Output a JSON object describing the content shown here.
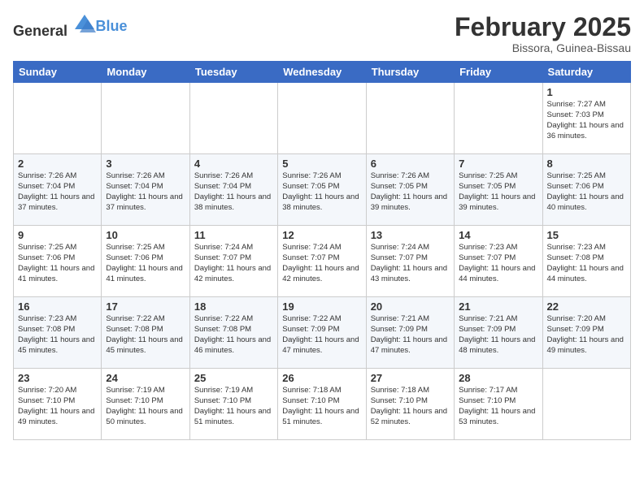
{
  "header": {
    "logo_general": "General",
    "logo_blue": "Blue",
    "month": "February 2025",
    "location": "Bissora, Guinea-Bissau"
  },
  "weekdays": [
    "Sunday",
    "Monday",
    "Tuesday",
    "Wednesday",
    "Thursday",
    "Friday",
    "Saturday"
  ],
  "weeks": [
    [
      {
        "day": "",
        "info": ""
      },
      {
        "day": "",
        "info": ""
      },
      {
        "day": "",
        "info": ""
      },
      {
        "day": "",
        "info": ""
      },
      {
        "day": "",
        "info": ""
      },
      {
        "day": "",
        "info": ""
      },
      {
        "day": "1",
        "info": "Sunrise: 7:27 AM\nSunset: 7:03 PM\nDaylight: 11 hours\nand 36 minutes."
      }
    ],
    [
      {
        "day": "2",
        "info": "Sunrise: 7:26 AM\nSunset: 7:04 PM\nDaylight: 11 hours\nand 37 minutes."
      },
      {
        "day": "3",
        "info": "Sunrise: 7:26 AM\nSunset: 7:04 PM\nDaylight: 11 hours\nand 37 minutes."
      },
      {
        "day": "4",
        "info": "Sunrise: 7:26 AM\nSunset: 7:04 PM\nDaylight: 11 hours\nand 38 minutes."
      },
      {
        "day": "5",
        "info": "Sunrise: 7:26 AM\nSunset: 7:05 PM\nDaylight: 11 hours\nand 38 minutes."
      },
      {
        "day": "6",
        "info": "Sunrise: 7:26 AM\nSunset: 7:05 PM\nDaylight: 11 hours\nand 39 minutes."
      },
      {
        "day": "7",
        "info": "Sunrise: 7:25 AM\nSunset: 7:05 PM\nDaylight: 11 hours\nand 39 minutes."
      },
      {
        "day": "8",
        "info": "Sunrise: 7:25 AM\nSunset: 7:06 PM\nDaylight: 11 hours\nand 40 minutes."
      }
    ],
    [
      {
        "day": "9",
        "info": "Sunrise: 7:25 AM\nSunset: 7:06 PM\nDaylight: 11 hours\nand 41 minutes."
      },
      {
        "day": "10",
        "info": "Sunrise: 7:25 AM\nSunset: 7:06 PM\nDaylight: 11 hours\nand 41 minutes."
      },
      {
        "day": "11",
        "info": "Sunrise: 7:24 AM\nSunset: 7:07 PM\nDaylight: 11 hours\nand 42 minutes."
      },
      {
        "day": "12",
        "info": "Sunrise: 7:24 AM\nSunset: 7:07 PM\nDaylight: 11 hours\nand 42 minutes."
      },
      {
        "day": "13",
        "info": "Sunrise: 7:24 AM\nSunset: 7:07 PM\nDaylight: 11 hours\nand 43 minutes."
      },
      {
        "day": "14",
        "info": "Sunrise: 7:23 AM\nSunset: 7:07 PM\nDaylight: 11 hours\nand 44 minutes."
      },
      {
        "day": "15",
        "info": "Sunrise: 7:23 AM\nSunset: 7:08 PM\nDaylight: 11 hours\nand 44 minutes."
      }
    ],
    [
      {
        "day": "16",
        "info": "Sunrise: 7:23 AM\nSunset: 7:08 PM\nDaylight: 11 hours\nand 45 minutes."
      },
      {
        "day": "17",
        "info": "Sunrise: 7:22 AM\nSunset: 7:08 PM\nDaylight: 11 hours\nand 45 minutes."
      },
      {
        "day": "18",
        "info": "Sunrise: 7:22 AM\nSunset: 7:08 PM\nDaylight: 11 hours\nand 46 minutes."
      },
      {
        "day": "19",
        "info": "Sunrise: 7:22 AM\nSunset: 7:09 PM\nDaylight: 11 hours\nand 47 minutes."
      },
      {
        "day": "20",
        "info": "Sunrise: 7:21 AM\nSunset: 7:09 PM\nDaylight: 11 hours\nand 47 minutes."
      },
      {
        "day": "21",
        "info": "Sunrise: 7:21 AM\nSunset: 7:09 PM\nDaylight: 11 hours\nand 48 minutes."
      },
      {
        "day": "22",
        "info": "Sunrise: 7:20 AM\nSunset: 7:09 PM\nDaylight: 11 hours\nand 49 minutes."
      }
    ],
    [
      {
        "day": "23",
        "info": "Sunrise: 7:20 AM\nSunset: 7:10 PM\nDaylight: 11 hours\nand 49 minutes."
      },
      {
        "day": "24",
        "info": "Sunrise: 7:19 AM\nSunset: 7:10 PM\nDaylight: 11 hours\nand 50 minutes."
      },
      {
        "day": "25",
        "info": "Sunrise: 7:19 AM\nSunset: 7:10 PM\nDaylight: 11 hours\nand 51 minutes."
      },
      {
        "day": "26",
        "info": "Sunrise: 7:18 AM\nSunset: 7:10 PM\nDaylight: 11 hours\nand 51 minutes."
      },
      {
        "day": "27",
        "info": "Sunrise: 7:18 AM\nSunset: 7:10 PM\nDaylight: 11 hours\nand 52 minutes."
      },
      {
        "day": "28",
        "info": "Sunrise: 7:17 AM\nSunset: 7:10 PM\nDaylight: 11 hours\nand 53 minutes."
      },
      {
        "day": "",
        "info": ""
      }
    ]
  ]
}
